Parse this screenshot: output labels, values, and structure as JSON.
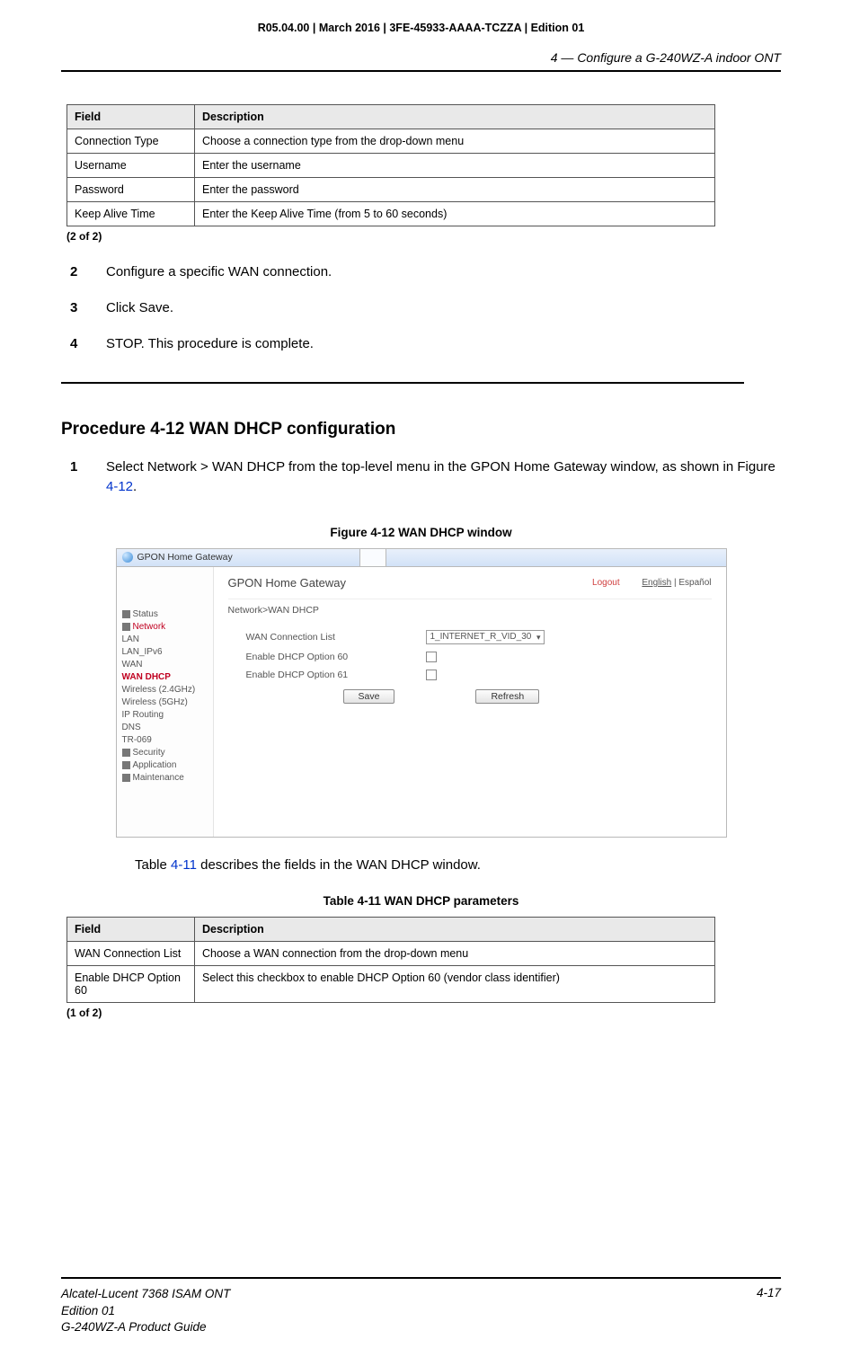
{
  "meta": {
    "doc_line": "R05.04.00 | March 2016 | 3FE-45933-AAAA-TCZZA | Edition 01",
    "running_head": "4 —  Configure a G-240WZ-A indoor ONT"
  },
  "table_a": {
    "headers": {
      "field": "Field",
      "desc": "Description"
    },
    "rows": [
      {
        "field": "Connection Type",
        "desc": "Choose a connection type from the drop-down menu"
      },
      {
        "field": "Username",
        "desc": "Enter the username"
      },
      {
        "field": "Password",
        "desc": "Enter the password"
      },
      {
        "field": "Keep Alive Time",
        "desc": "Enter the Keep Alive Time (from 5 to 60 seconds)"
      }
    ],
    "note": "(2 of 2)"
  },
  "steps_a": [
    {
      "n": "2",
      "t": "Configure a specific WAN connection."
    },
    {
      "n": "3",
      "t": "Click Save."
    },
    {
      "n": "4",
      "t": "STOP. This procedure is complete."
    }
  ],
  "proc_heading": "Procedure 4-12  WAN DHCP configuration",
  "step_b": {
    "n": "1",
    "pre": "Select Network > WAN DHCP from the top-level menu in the GPON Home Gateway window, as shown in Figure ",
    "ref": "4-12",
    "post": "."
  },
  "fig": {
    "caption": "Figure 4-12  WAN DHCP window",
    "tab_title": "GPON Home Gateway",
    "banner_title": "GPON Home Gateway",
    "logout": "Logout",
    "lang_en": "English",
    "lang_sep": " | ",
    "lang_es": "Español",
    "crumb": "Network>WAN DHCP",
    "sidebar": {
      "status": "Status",
      "network": "Network",
      "items": [
        "LAN",
        "LAN_IPv6",
        "WAN",
        "WAN DHCP",
        "Wireless (2.4GHz)",
        "Wireless (5GHz)",
        "IP Routing",
        "DNS",
        "TR-069"
      ],
      "active_idx": 3,
      "security": "Security",
      "application": "Application",
      "maintenance": "Maintenance"
    },
    "rows": [
      {
        "label": "WAN Connection List",
        "type": "select",
        "value": "1_INTERNET_R_VID_30"
      },
      {
        "label": "Enable DHCP Option 60",
        "type": "check"
      },
      {
        "label": "Enable DHCP Option 61",
        "type": "check"
      }
    ],
    "buttons": {
      "save": "Save",
      "refresh": "Refresh"
    }
  },
  "after_fig": {
    "pre": "Table ",
    "ref": "4-11",
    "post": " describes the fields in the WAN DHCP window."
  },
  "table_b": {
    "caption": "Table 4-11 WAN DHCP parameters",
    "headers": {
      "field": "Field",
      "desc": "Description"
    },
    "rows": [
      {
        "field": "WAN Connection List",
        "desc": "Choose a WAN connection from the drop-down menu"
      },
      {
        "field": "Enable DHCP Option 60",
        "desc": "Select this checkbox to enable DHCP Option 60 (vendor class identifier)"
      }
    ],
    "note": "(1 of 2)"
  },
  "footer": {
    "l1": "Alcatel-Lucent 7368 ISAM ONT",
    "l2": "Edition 01",
    "l3": "G-240WZ-A Product Guide",
    "page": "4-17"
  }
}
